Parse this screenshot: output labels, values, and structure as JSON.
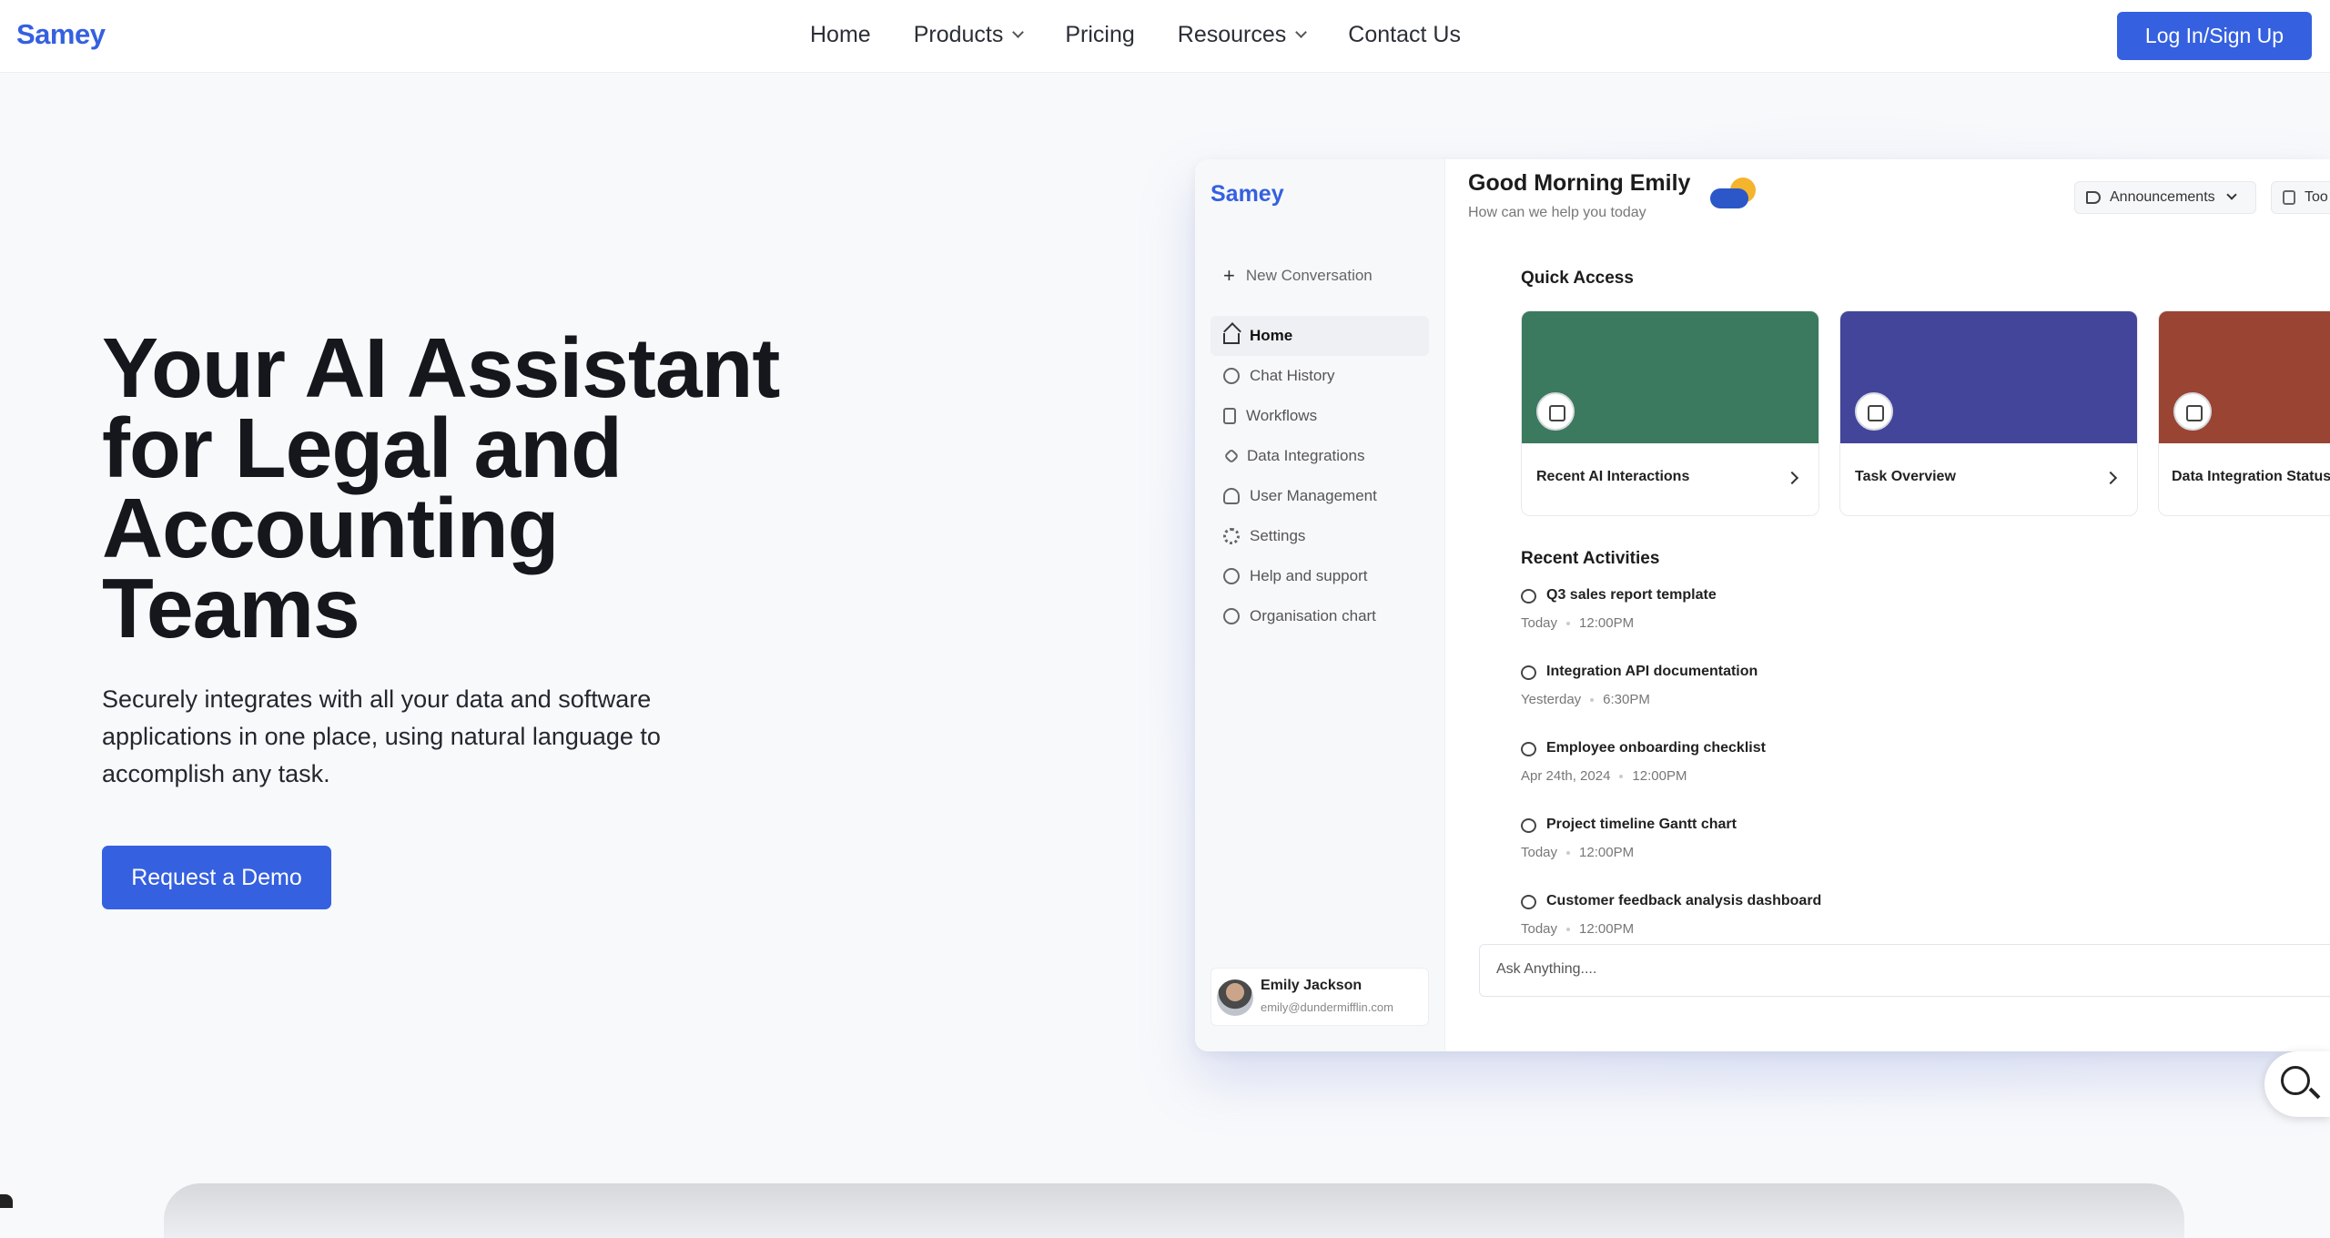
{
  "nav": {
    "brand": "Samey",
    "items": [
      {
        "label": "Home",
        "dropdown": false
      },
      {
        "label": "Products",
        "dropdown": true
      },
      {
        "label": "Pricing",
        "dropdown": false
      },
      {
        "label": "Resources",
        "dropdown": true
      },
      {
        "label": "Contact Us",
        "dropdown": false
      }
    ],
    "login_label": "Log In/Sign Up"
  },
  "hero": {
    "title": "Your AI Assistant for Legal and Accounting Teams",
    "subtitle": "Securely integrates with all your data and software applications in one place, using natural language to accomplish any task.",
    "cta_label": "Request a Demo"
  },
  "app": {
    "brand": "Samey",
    "greeting": "Good Morning Emily",
    "greeting_sub": "How can we help you today",
    "announcements_label": "Announcements",
    "tools_label": "Too",
    "new_conversation": "New Conversation",
    "sidebar": [
      {
        "label": "Home",
        "icon": "home-icon",
        "active": true
      },
      {
        "label": "Chat History",
        "icon": "chat-icon"
      },
      {
        "label": "Workflows",
        "icon": "document-icon"
      },
      {
        "label": "Data Integrations",
        "icon": "link-icon"
      },
      {
        "label": "User Management",
        "icon": "user-icon"
      },
      {
        "label": "Settings",
        "icon": "gear-icon"
      },
      {
        "label": "Help and support",
        "icon": "help-icon"
      },
      {
        "label": "Organisation chart",
        "icon": "chart-icon"
      }
    ],
    "user": {
      "name": "Emily Jackson",
      "email": "emily@dundermifflin.com"
    },
    "quick_access_title": "Quick Access",
    "cards": [
      {
        "label": "Recent AI Interactions",
        "color": "#3b7a5e"
      },
      {
        "label": "Task Overview",
        "color": "#43459a"
      },
      {
        "label": "Data Integration Status",
        "color": "#9a4433"
      }
    ],
    "recent_title": "Recent Activities",
    "activities": [
      {
        "title": "Q3 sales report template",
        "date": "Today",
        "time": "12:00PM"
      },
      {
        "title": "Integration API documentation",
        "date": "Yesterday",
        "time": "6:30PM"
      },
      {
        "title": "Employee onboarding checklist",
        "date": "Apr 24th, 2024",
        "time": "12:00PM"
      },
      {
        "title": "Project timeline Gantt chart",
        "date": "Today",
        "time": "12:00PM"
      },
      {
        "title": "Customer feedback analysis dashboard",
        "date": "Today",
        "time": "12:00PM"
      }
    ],
    "ask_placeholder": "Ask Anything...."
  },
  "colors": {
    "accent": "#3560e0"
  }
}
